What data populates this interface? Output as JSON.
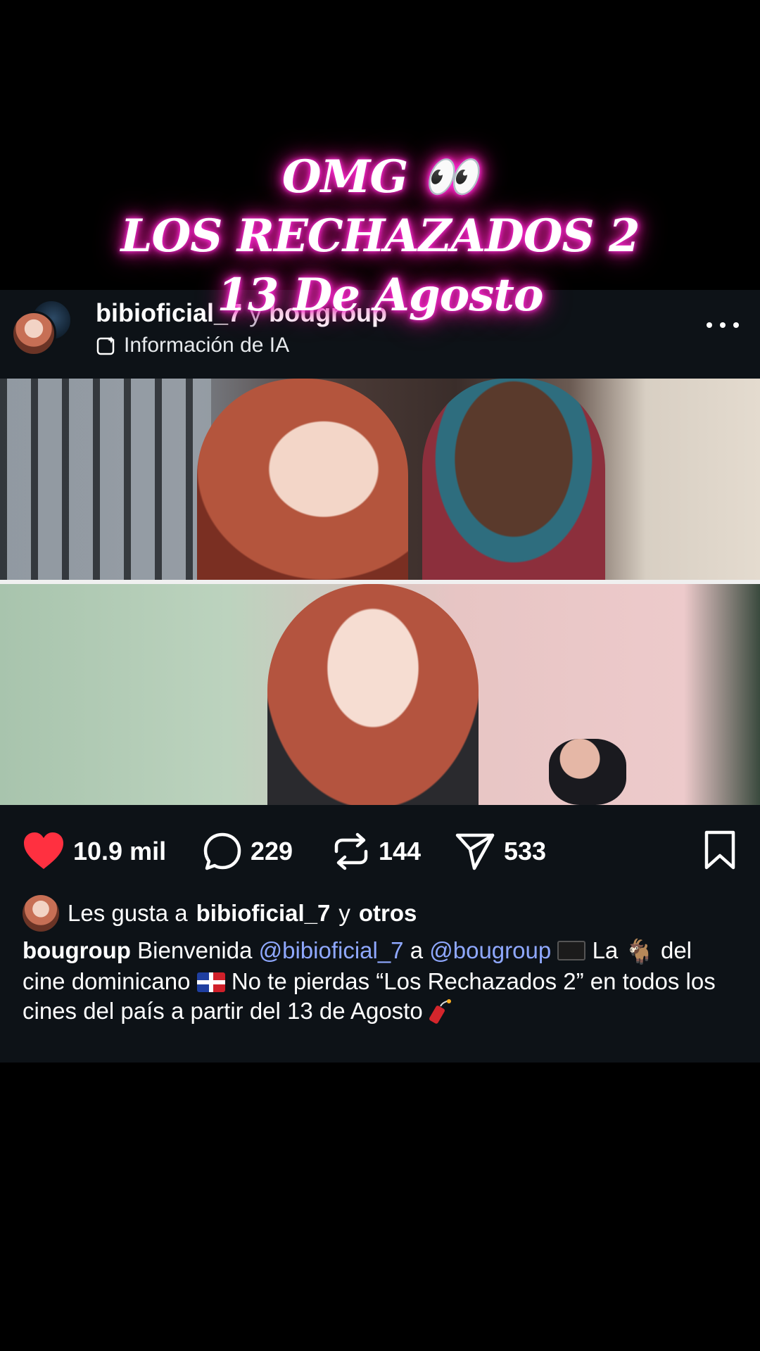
{
  "overlay": {
    "line1": "OMG 👀",
    "line2": "LOS RECHAZADOS 2",
    "line3": "13 De Agosto",
    "glow_color": "#ff2bd6"
  },
  "post": {
    "header": {
      "username": "bibioficial_7",
      "connector": "y",
      "coauthor": "bougroup",
      "ai_info": "Información de IA",
      "more_icon": "more-horizontal-icon"
    },
    "actions": {
      "like_count": "10.9 mil",
      "comment_count": "229",
      "repost_count": "144",
      "share_count": "533",
      "like_color": "#ff3040"
    },
    "likes": {
      "prefix": "Les gusta a",
      "user": "bibioficial_7",
      "connector": "y",
      "others": "otros"
    },
    "caption": {
      "user": "bougroup",
      "text1": "Bienvenida",
      "mention1": "@bibioficial_7",
      "text2": "a",
      "mention2": "@bougroup",
      "text3": "La",
      "text4": "del cine dominicano",
      "text5": "No te pierdas “Los Rechazados 2” en todos los cines del país a partir del 13 de Agosto",
      "goat_emoji": "🐐",
      "mention_color": "#8fa8ff"
    }
  }
}
